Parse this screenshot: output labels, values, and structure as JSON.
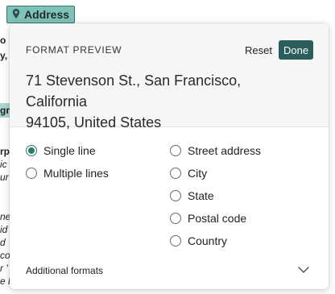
{
  "background": {
    "chip_label": "Address",
    "fragments": [
      "o",
      "y,",
      "gr",
      "rp",
      "ic",
      "ur",
      "ne",
      "id",
      "d",
      "co",
      "r '",
      "e l"
    ]
  },
  "popover": {
    "title": "FORMAT PREVIEW",
    "reset_label": "Reset",
    "done_label": "Done",
    "preview_line1": "71 Stevenson St., San Francisco, California",
    "preview_line2": "94105, United States",
    "left_options": [
      {
        "label": "Single line",
        "checked": true
      },
      {
        "label": "Multiple lines",
        "checked": false
      }
    ],
    "right_options": [
      {
        "label": "Street address",
        "checked": false
      },
      {
        "label": "City",
        "checked": false
      },
      {
        "label": "State",
        "checked": false
      },
      {
        "label": "Postal code",
        "checked": false
      },
      {
        "label": "Country",
        "checked": false
      }
    ],
    "additional_label": "Additional formats"
  },
  "colors": {
    "accent": "#2b5d5d",
    "radio_checked": "#2b7a6a",
    "chip_bg": "#7ec2b8"
  }
}
